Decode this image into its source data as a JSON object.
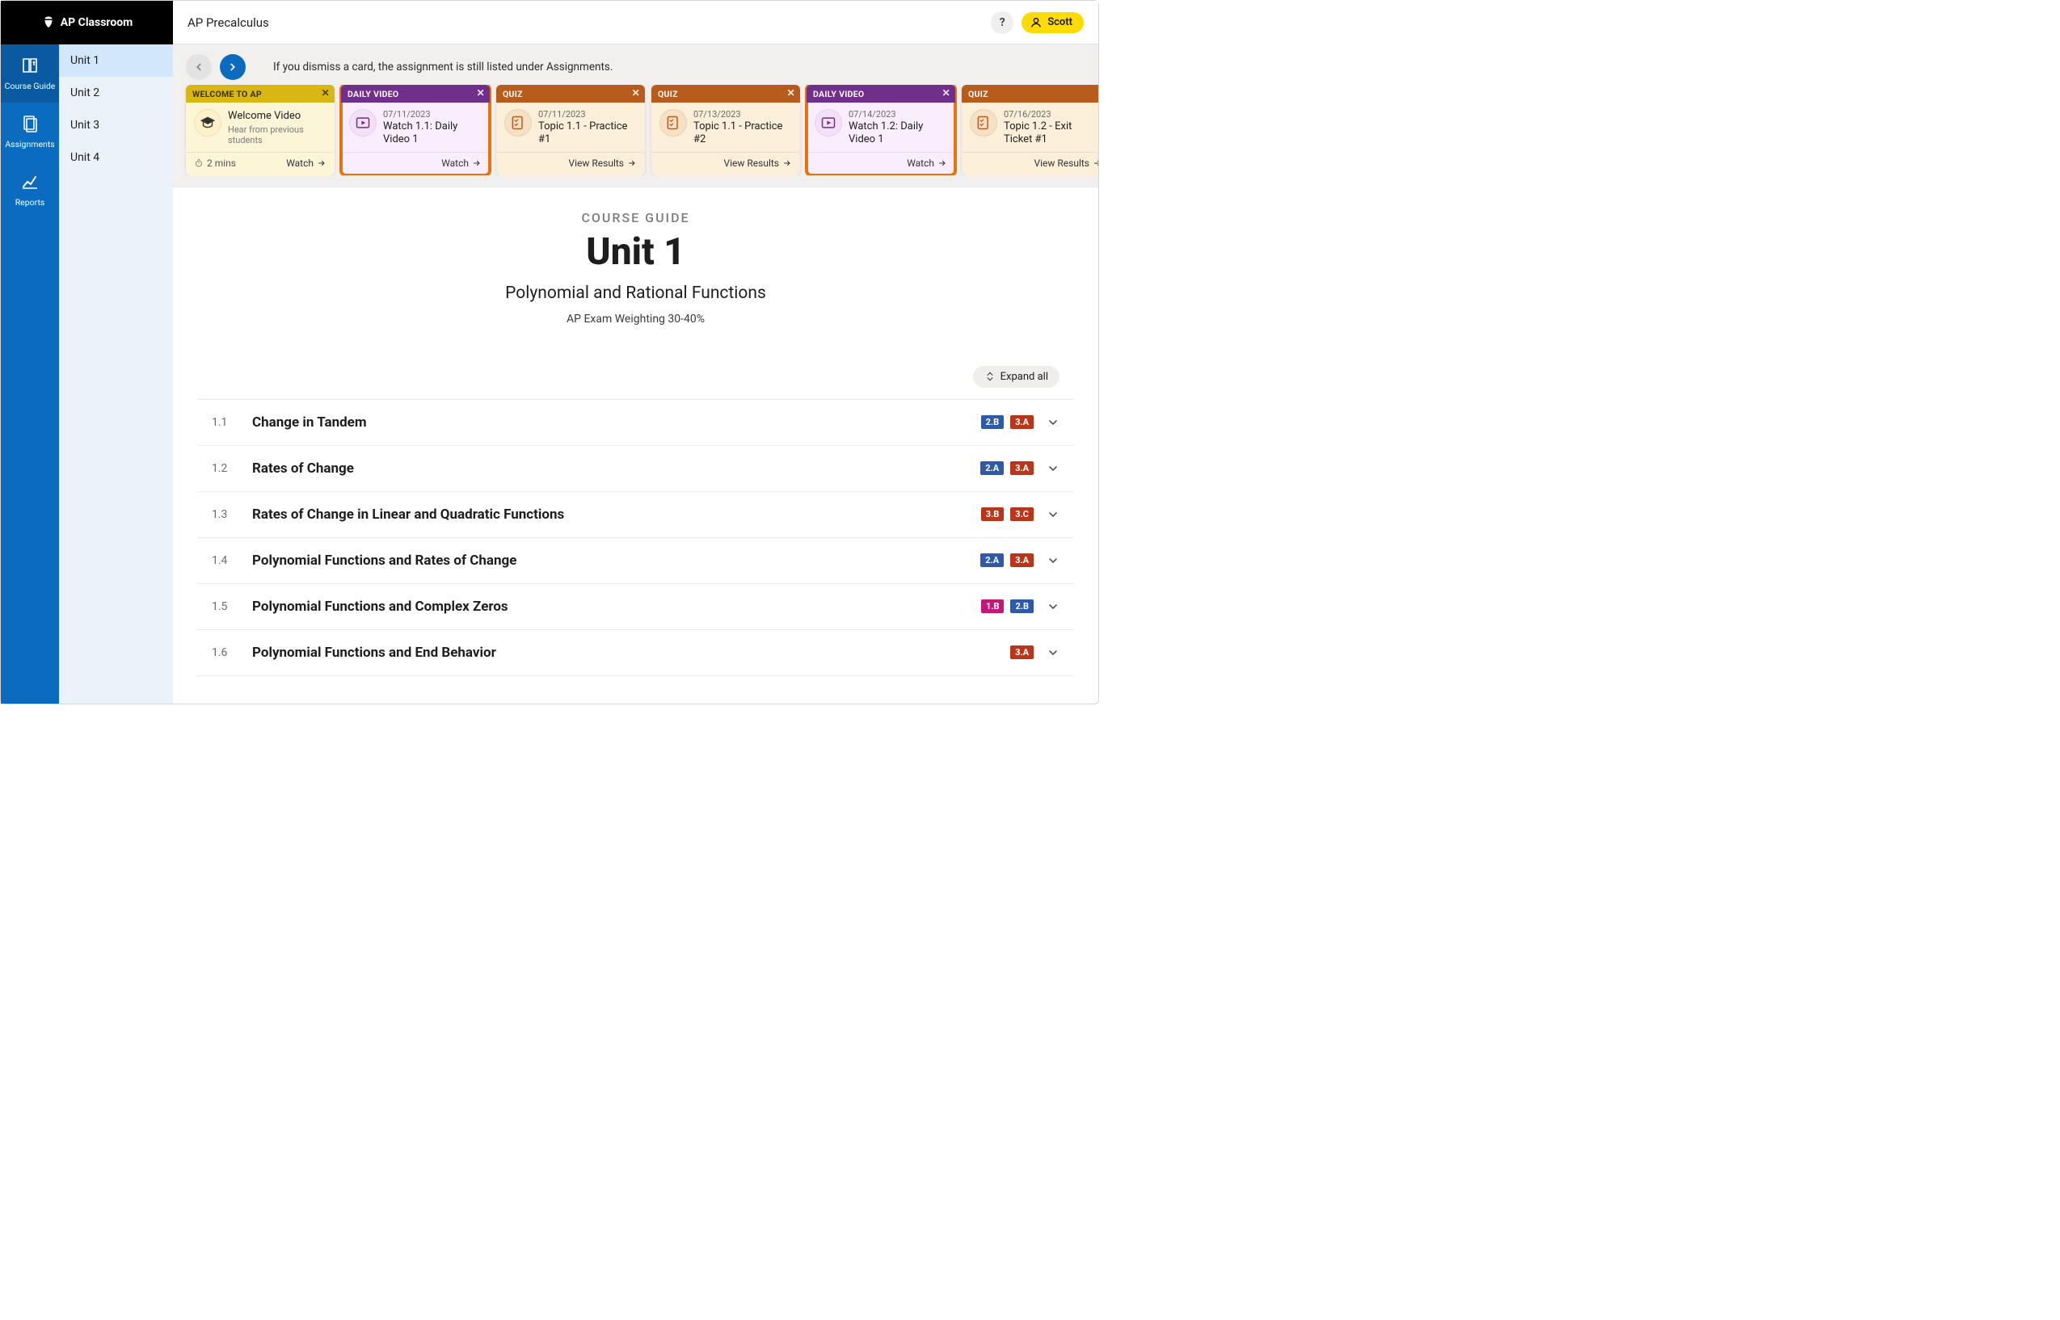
{
  "brand": "AP Classroom",
  "course_title": "AP Precalculus",
  "user_name": "Scott",
  "help_glyph": "?",
  "rail": [
    {
      "id": "course-guide",
      "label": "Course Guide",
      "active": true
    },
    {
      "id": "assignments",
      "label": "Assignments",
      "active": false
    },
    {
      "id": "reports",
      "label": "Reports",
      "active": false
    }
  ],
  "units": [
    {
      "label": "Unit 1",
      "active": true
    },
    {
      "label": "Unit 2",
      "active": false
    },
    {
      "label": "Unit 3",
      "active": false
    },
    {
      "label": "Unit 4",
      "active": false
    }
  ],
  "carousel_hint": "If you dismiss a card, the assignment is still listed under Assignments.",
  "cards": [
    {
      "type": "welcome",
      "head": "WELCOME TO AP",
      "title": "Welcome Video",
      "sub": "Hear from previous students",
      "duration": "2 mins",
      "action": "Watch",
      "highlight": false
    },
    {
      "type": "video",
      "head": "DAILY VIDEO",
      "date": "07/11/2023",
      "title": "Watch 1.1: Daily Video 1",
      "action": "Watch",
      "highlight": true
    },
    {
      "type": "quiz",
      "head": "QUIZ",
      "date": "07/11/2023",
      "title": "Topic 1.1 - Practice #1",
      "action": "View Results",
      "highlight": false
    },
    {
      "type": "quiz",
      "head": "QUIZ",
      "date": "07/13/2023",
      "title": "Topic 1.1 - Practice #2",
      "action": "View Results",
      "highlight": false
    },
    {
      "type": "video",
      "head": "DAILY VIDEO",
      "date": "07/14/2023",
      "title": "Watch 1.2: Daily Video 1",
      "action": "Watch",
      "highlight": true
    },
    {
      "type": "quiz",
      "head": "QUIZ",
      "date": "07/16/2023",
      "title": "Topic 1.2 - Exit Ticket #1",
      "action": "View Results",
      "highlight": false
    }
  ],
  "course_header": {
    "eyebrow": "COURSE GUIDE",
    "title": "Unit 1",
    "subtitle": "Polynomial and Rational Functions",
    "weighting": "AP Exam Weighting 30-40%"
  },
  "expand_all_label": "Expand all",
  "topics": [
    {
      "num": "1.1",
      "title": "Change in Tandem",
      "tags": [
        {
          "t": "2.B",
          "c": "c-2B"
        },
        {
          "t": "3.A",
          "c": "c-3A"
        }
      ]
    },
    {
      "num": "1.2",
      "title": "Rates of Change",
      "tags": [
        {
          "t": "2.A",
          "c": "c-2A"
        },
        {
          "t": "3.A",
          "c": "c-3A"
        }
      ]
    },
    {
      "num": "1.3",
      "title": "Rates of Change in Linear and Quadratic Functions",
      "tags": [
        {
          "t": "3.B",
          "c": "c-3B"
        },
        {
          "t": "3.C",
          "c": "c-3C"
        }
      ]
    },
    {
      "num": "1.4",
      "title": "Polynomial Functions and Rates of Change",
      "tags": [
        {
          "t": "2.A",
          "c": "c-2A"
        },
        {
          "t": "3.A",
          "c": "c-3A"
        }
      ]
    },
    {
      "num": "1.5",
      "title": "Polynomial Functions and Complex Zeros",
      "tags": [
        {
          "t": "1.B",
          "c": "c-1B"
        },
        {
          "t": "2.B",
          "c": "c-2B"
        }
      ]
    },
    {
      "num": "1.6",
      "title": "Polynomial Functions and End Behavior",
      "tags": [
        {
          "t": "3.A",
          "c": "c-3A"
        }
      ]
    }
  ]
}
